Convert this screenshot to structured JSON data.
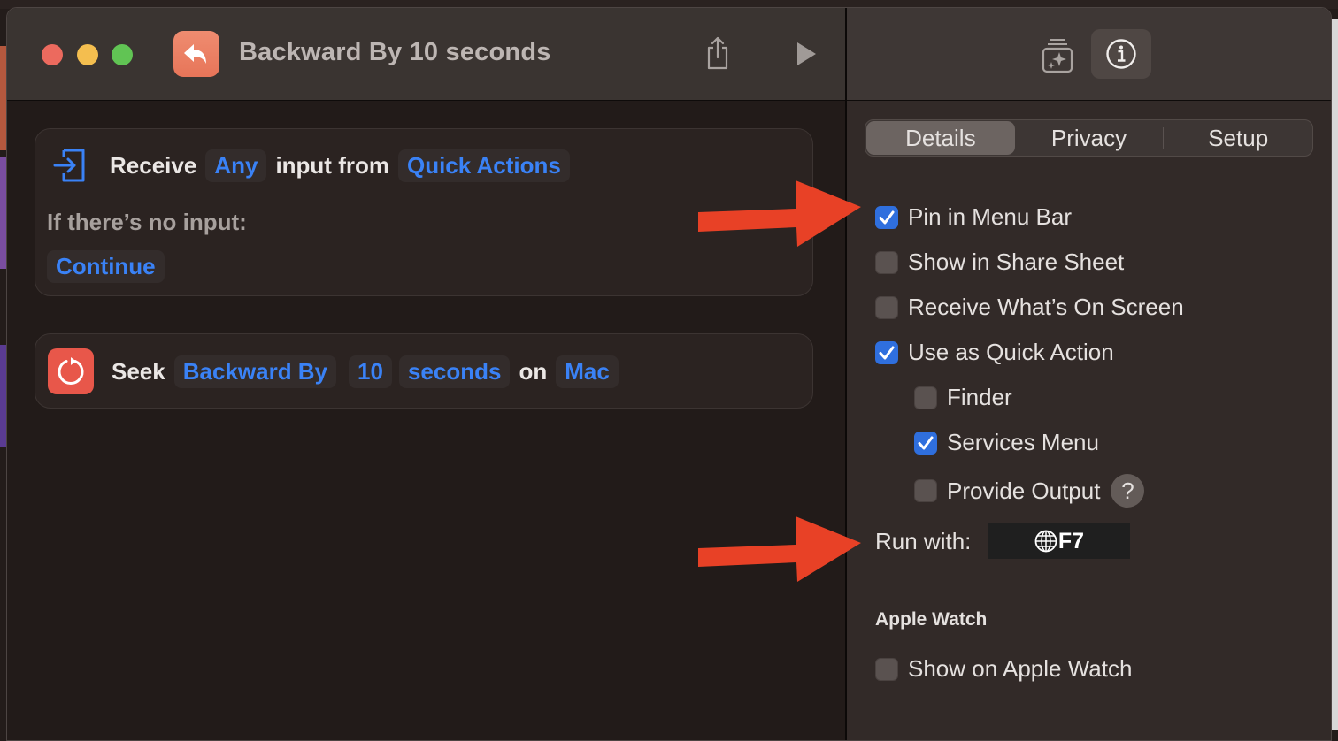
{
  "window": {
    "title": "Backward By 10 seconds",
    "app_icon": "reply-arrow-icon",
    "toolbar": {
      "share_icon": "share-icon",
      "run_icon": "play-icon",
      "library_icon": "sparkle-stack-icon",
      "info_icon": "info-icon"
    }
  },
  "actions": [
    {
      "icon": "receive-input-icon",
      "verb": "Receive",
      "type_token": "Any",
      "middle": "input from",
      "source_token": "Quick Actions",
      "no_input_label": "If there’s no input:",
      "no_input_token": "Continue"
    },
    {
      "icon": "seek-icon",
      "verb": "Seek",
      "direction_token": "Backward By",
      "amount_token": "10",
      "unit_token": "seconds",
      "on_label": "on",
      "device_token": "Mac"
    }
  ],
  "details": {
    "tabs": [
      {
        "label": "Details",
        "active": true
      },
      {
        "label": "Privacy",
        "active": false
      },
      {
        "label": "Setup",
        "active": false
      }
    ],
    "options": [
      {
        "label": "Pin in Menu Bar",
        "checked": true
      },
      {
        "label": "Show in Share Sheet",
        "checked": false
      },
      {
        "label": "Receive What’s On Screen",
        "checked": false
      },
      {
        "label": "Use as Quick Action",
        "checked": true
      },
      {
        "label": "Finder",
        "checked": false
      },
      {
        "label": "Services Menu",
        "checked": true
      },
      {
        "label": "Provide Output",
        "checked": false
      }
    ],
    "help_label": "?",
    "run_with_label": "Run with:",
    "run_with_shortcut": "F7",
    "run_with_icon": "globe-icon",
    "apple_watch_title": "Apple Watch",
    "apple_watch_option": {
      "label": "Show on Apple Watch",
      "checked": false
    }
  },
  "annotations": {
    "arrow_color": "#e84126",
    "arrows": [
      "points-to-pin-in-menu-bar",
      "points-to-run-with"
    ]
  },
  "colors": {
    "accent": "#3a82f6",
    "checkbox_on": "#2f6fde",
    "seek_icon_bg": "#e8574a"
  }
}
